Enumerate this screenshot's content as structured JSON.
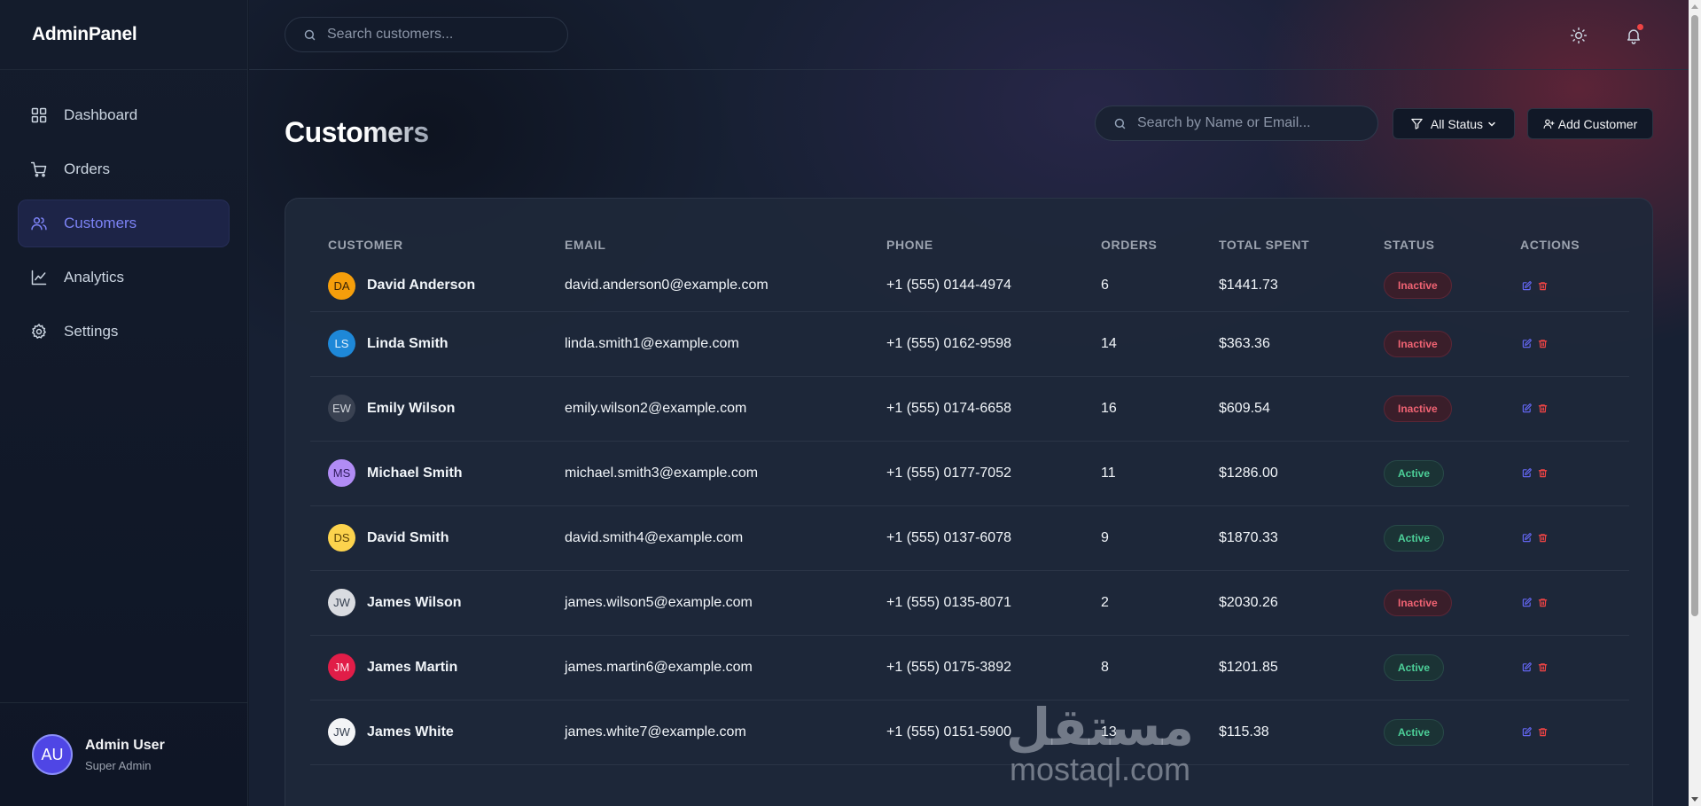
{
  "brand": "AdminPanel",
  "sidebar": {
    "items": [
      {
        "label": "Dashboard",
        "icon": "grid-icon",
        "active": false
      },
      {
        "label": "Orders",
        "icon": "cart-icon",
        "active": false
      },
      {
        "label": "Customers",
        "icon": "users-icon",
        "active": true
      },
      {
        "label": "Analytics",
        "icon": "chart-line-icon",
        "active": false
      },
      {
        "label": "Settings",
        "icon": "gear-icon",
        "active": false
      }
    ],
    "user": {
      "initials": "AU",
      "name": "Admin User",
      "role": "Super Admin"
    }
  },
  "topbar": {
    "search_placeholder": "Search customers...",
    "icons": [
      "sun-icon",
      "bell-icon"
    ]
  },
  "page": {
    "title": "Customers",
    "filter_placeholder": "Search by Name or Email...",
    "status_button": "All Status",
    "add_button": "Add Customer"
  },
  "table": {
    "columns": [
      "Customer",
      "Email",
      "Phone",
      "Orders",
      "Total Spent",
      "Status",
      "Actions"
    ],
    "rows": [
      {
        "initials": "DA",
        "name": "David Anderson",
        "email": "david.anderson0@example.com",
        "phone": "+1 (555) 0144-4974",
        "orders": "6",
        "total": "$1441.73",
        "status": "Inactive",
        "avatar_bg": "#f59e0b",
        "avatar_fg": "#3b2407"
      },
      {
        "initials": "LS",
        "name": "Linda Smith",
        "email": "linda.smith1@example.com",
        "phone": "+1 (555) 0162-9598",
        "orders": "14",
        "total": "$363.36",
        "status": "Inactive",
        "avatar_bg": "#1e88d8",
        "avatar_fg": "#e6f2fc"
      },
      {
        "initials": "EW",
        "name": "Emily Wilson",
        "email": "emily.wilson2@example.com",
        "phone": "+1 (555) 0174-6658",
        "orders": "16",
        "total": "$609.54",
        "status": "Inactive",
        "avatar_bg": "#3a4252",
        "avatar_fg": "#d1d5db"
      },
      {
        "initials": "MS",
        "name": "Michael Smith",
        "email": "michael.smith3@example.com",
        "phone": "+1 (555) 0177-7052",
        "orders": "11",
        "total": "$1286.00",
        "status": "Active",
        "avatar_bg": "#b18cf5",
        "avatar_fg": "#2e1a5c"
      },
      {
        "initials": "DS",
        "name": "David Smith",
        "email": "david.smith4@example.com",
        "phone": "+1 (555) 0137-6078",
        "orders": "9",
        "total": "$1870.33",
        "status": "Active",
        "avatar_bg": "#fcd34d",
        "avatar_fg": "#5a4206"
      },
      {
        "initials": "JW",
        "name": "James Wilson",
        "email": "james.wilson5@example.com",
        "phone": "+1 (555) 0135-8071",
        "orders": "2",
        "total": "$2030.26",
        "status": "Inactive",
        "avatar_bg": "#d9dbe0",
        "avatar_fg": "#374151"
      },
      {
        "initials": "JM",
        "name": "James Martin",
        "email": "james.martin6@example.com",
        "phone": "+1 (555) 0175-3892",
        "orders": "8",
        "total": "$1201.85",
        "status": "Active",
        "avatar_bg": "#e11d48",
        "avatar_fg": "#fde8ee"
      },
      {
        "initials": "JW",
        "name": "James White",
        "email": "james.white7@example.com",
        "phone": "+1 (555) 0151-5900",
        "orders": "13",
        "total": "$115.38",
        "status": "Active",
        "avatar_bg": "#f3f4f6",
        "avatar_fg": "#374151"
      }
    ],
    "action_icons": [
      "edit-icon",
      "trash-icon"
    ]
  },
  "watermark": {
    "arabic": "مستقل",
    "latin": "mostaql.com"
  },
  "colors": {
    "accent": "#7c83f5",
    "inactive": "#f06373",
    "active": "#4ccf98",
    "edit": "#6366f1",
    "delete": "#ef4444"
  }
}
